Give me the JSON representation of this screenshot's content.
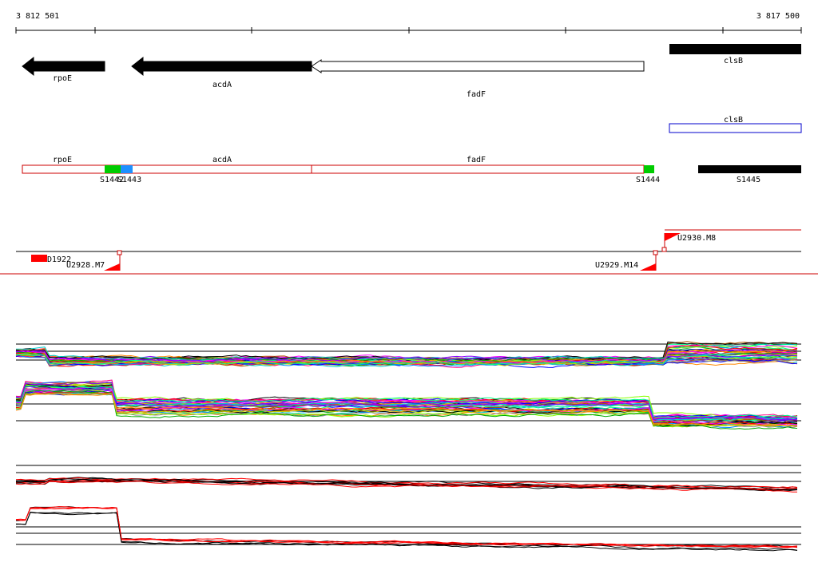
{
  "coordinates": {
    "start": "3 812 501",
    "end": "3 817 500"
  },
  "genes": [
    {
      "name": "rpoE",
      "fill": "#000000"
    },
    {
      "name": "acdA",
      "fill": "#000000"
    },
    {
      "name": "fadF",
      "fill": "#ffffff"
    },
    {
      "name": "clsB",
      "fill": "#000000"
    }
  ],
  "alt_feature": {
    "name": "clsB",
    "stroke": "#0000cc"
  },
  "transcript_labels": [
    "rpoE",
    "acdA",
    "fadF"
  ],
  "segments": [
    {
      "name": "S1442",
      "color": "#00cc00"
    },
    {
      "name": "S1443",
      "color": "#1e90ff"
    },
    {
      "name": "S1444",
      "color": "#00cc00"
    },
    {
      "name": "S1445",
      "color": "#000000"
    }
  ],
  "markers": [
    {
      "name": "D1922",
      "color": "#ff0000"
    },
    {
      "name": "U2928.M7",
      "color": "#ff0000"
    },
    {
      "name": "U2929.M14",
      "color": "#ff0000"
    },
    {
      "name": "U2930.M8",
      "color": "#ff0000"
    }
  ],
  "colors": {
    "transcript": "#cc0000",
    "gene_stroke": "#000000"
  },
  "tracks": [
    {
      "id": "profiles-1",
      "series_count": 40
    },
    {
      "id": "profiles-2",
      "series_count": 40
    },
    {
      "id": "summary-1",
      "series_count": 8
    },
    {
      "id": "summary-2",
      "series_count": 6
    }
  ]
}
